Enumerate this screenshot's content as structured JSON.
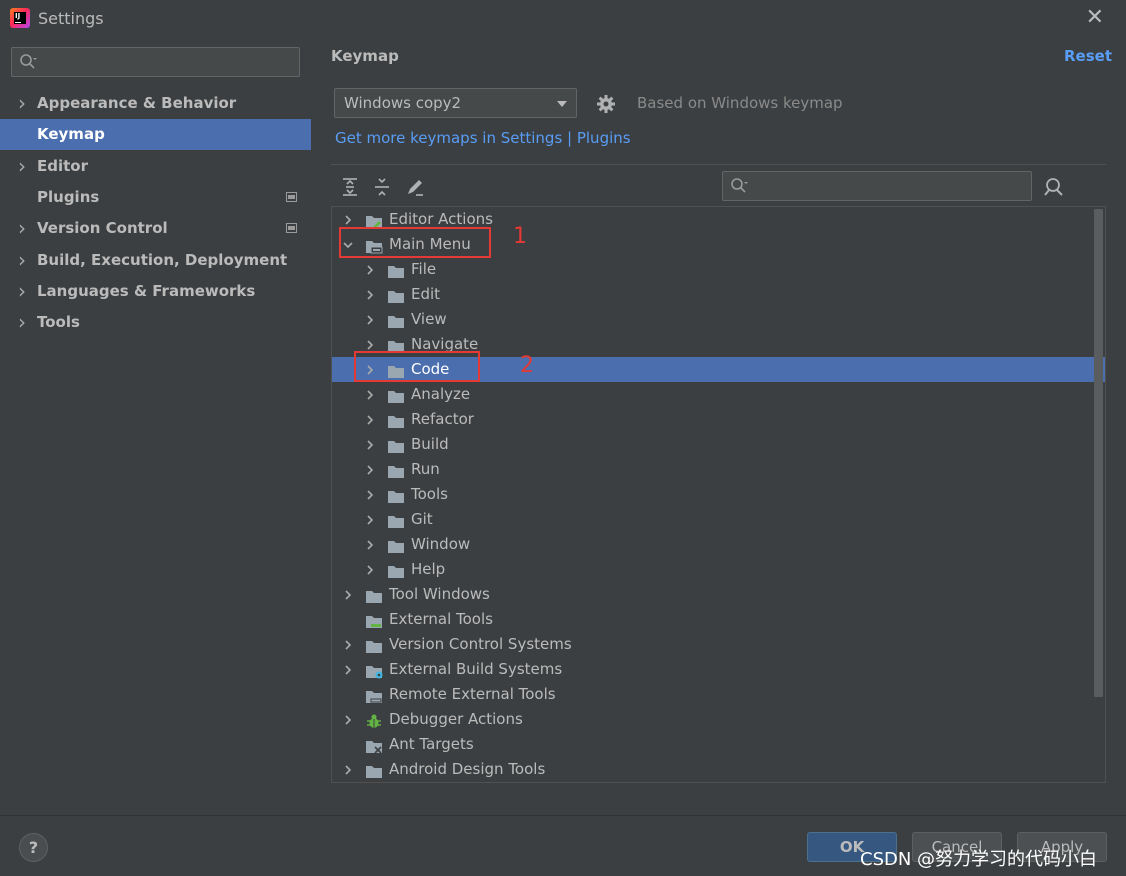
{
  "window": {
    "title": "Settings",
    "close_glyph": "✕"
  },
  "sidebar": {
    "search_placeholder": "",
    "items": [
      {
        "label": "Appearance & Behavior",
        "expandable": true
      },
      {
        "label": "Keymap",
        "expandable": false,
        "selected": true
      },
      {
        "label": "Editor",
        "expandable": true
      },
      {
        "label": "Plugins",
        "expandable": false,
        "badge": true
      },
      {
        "label": "Version Control",
        "expandable": true,
        "badge": true
      },
      {
        "label": "Build, Execution, Deployment",
        "expandable": true
      },
      {
        "label": "Languages & Frameworks",
        "expandable": true
      },
      {
        "label": "Tools",
        "expandable": true
      }
    ]
  },
  "main": {
    "title": "Keymap",
    "reset_label": "Reset",
    "keymap_value": "Windows copy2",
    "based_on": "Based on Windows keymap",
    "more_keymaps_link": "Get more keymaps in Settings | Plugins",
    "tree_search_placeholder": "",
    "tree": [
      {
        "label": "Editor Actions",
        "level": 0,
        "chevron": ">",
        "icon": "editor-actions-icon"
      },
      {
        "label": "Main Menu",
        "level": 0,
        "chevron": "v",
        "icon": "main-menu-icon"
      },
      {
        "label": "File",
        "level": 1,
        "chevron": ">",
        "icon": "folder-icon"
      },
      {
        "label": "Edit",
        "level": 1,
        "chevron": ">",
        "icon": "folder-icon"
      },
      {
        "label": "View",
        "level": 1,
        "chevron": ">",
        "icon": "folder-icon"
      },
      {
        "label": "Navigate",
        "level": 1,
        "chevron": ">",
        "icon": "folder-icon"
      },
      {
        "label": "Code",
        "level": 1,
        "chevron": ">",
        "icon": "folder-icon",
        "selected": true
      },
      {
        "label": "Analyze",
        "level": 1,
        "chevron": ">",
        "icon": "folder-icon"
      },
      {
        "label": "Refactor",
        "level": 1,
        "chevron": ">",
        "icon": "folder-icon"
      },
      {
        "label": "Build",
        "level": 1,
        "chevron": ">",
        "icon": "folder-icon"
      },
      {
        "label": "Run",
        "level": 1,
        "chevron": ">",
        "icon": "folder-icon"
      },
      {
        "label": "Tools",
        "level": 1,
        "chevron": ">",
        "icon": "folder-icon"
      },
      {
        "label": "Git",
        "level": 1,
        "chevron": ">",
        "icon": "folder-icon"
      },
      {
        "label": "Window",
        "level": 1,
        "chevron": ">",
        "icon": "folder-icon"
      },
      {
        "label": "Help",
        "level": 1,
        "chevron": ">",
        "icon": "folder-icon"
      },
      {
        "label": "Tool Windows",
        "level": 0,
        "chevron": ">",
        "icon": "folder-icon"
      },
      {
        "label": "External Tools",
        "level": 0,
        "chevron": "",
        "icon": "external-tools-icon"
      },
      {
        "label": "Version Control Systems",
        "level": 0,
        "chevron": ">",
        "icon": "folder-icon"
      },
      {
        "label": "External Build Systems",
        "level": 0,
        "chevron": ">",
        "icon": "external-build-icon"
      },
      {
        "label": "Remote External Tools",
        "level": 0,
        "chevron": "",
        "icon": "remote-tools-icon"
      },
      {
        "label": "Debugger Actions",
        "level": 0,
        "chevron": ">",
        "icon": "bug-icon"
      },
      {
        "label": "Ant Targets",
        "level": 0,
        "chevron": "",
        "icon": "ant-icon"
      },
      {
        "label": "Android Design Tools",
        "level": 0,
        "chevron": ">",
        "icon": "folder-icon"
      }
    ],
    "annotations": [
      "1",
      "2"
    ]
  },
  "footer": {
    "help_label": "?",
    "ok_label": "OK",
    "cancel_label": "Cancel",
    "apply_label": "Apply",
    "watermark": "CSDN @努力学习的代码小白"
  },
  "colors": {
    "background": "#3c3f41",
    "selection": "#4b6eaf",
    "link": "#589df6",
    "annotation": "#e53935"
  }
}
